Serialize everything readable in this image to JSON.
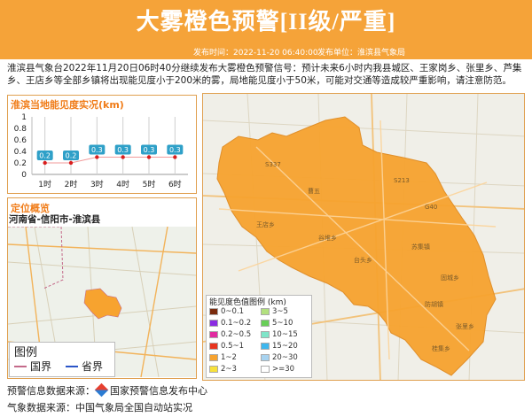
{
  "header": {
    "title": "大雾橙色预警[II级/严重]",
    "time_label": "发布时间：2022-11-20 06:40:00",
    "unit_label": "发布单位：淮滨县气象局",
    "bg_color": "#f5a339"
  },
  "description": "淮滨县气象台2022年11月20日06时40分继续发布大雾橙色预警信号：预计未来6小时内我县城区、王家岗乡、张里乡、芦集乡、王店乡等全部乡镇将出现能见度小于200米的雾，局地能见度小于50米，可能对交通等造成较严重影响，请注意防范。",
  "chart_panel": {
    "title": "淮滨当地能见度实况(km)"
  },
  "chart_data": {
    "type": "line",
    "categories": [
      "1时",
      "2时",
      "3时",
      "4时",
      "5时",
      "6时"
    ],
    "values": [
      0.2,
      0.2,
      0.3,
      0.3,
      0.3,
      0.3
    ],
    "ylim": [
      0,
      1
    ],
    "yticks": [
      "1",
      "0.8",
      "0.6",
      "0.4",
      "0.2",
      "0"
    ],
    "grid": true
  },
  "locator": {
    "title": "定位概览",
    "region": "河南省-信阳市-淮滨县",
    "legend_title": "图例",
    "legend_items": [
      {
        "label": "国界",
        "color": "#c46a8a"
      },
      {
        "label": "省界",
        "color": "#2b55c8"
      }
    ]
  },
  "visibility_legend": {
    "title": "能见度色值图例 (km)",
    "items": [
      {
        "label": "0~0.1",
        "color": "#7a2a0c"
      },
      {
        "label": "3~5",
        "color": "#b2e07e"
      },
      {
        "label": "0.1~0.2",
        "color": "#8a2be2"
      },
      {
        "label": "5~10",
        "color": "#68cf58"
      },
      {
        "label": "0.2~0.5",
        "color": "#e22ba0"
      },
      {
        "label": "10~15",
        "color": "#7fe5c9"
      },
      {
        "label": "0.5~1",
        "color": "#e8351f"
      },
      {
        "label": "15~20",
        "color": "#3eb7ee"
      },
      {
        "label": "1~2",
        "color": "#f7a32f"
      },
      {
        "label": "20~30",
        "color": "#a8d3f0"
      },
      {
        "label": "2~3",
        "color": "#f7e13b"
      },
      {
        "label": ">=30",
        "color": "#ffffff"
      }
    ]
  },
  "map_labels": {
    "inner": [
      "S337",
      "曹五",
      "S213",
      "G40",
      "王店乡",
      "谷堆乡",
      "台头乡",
      "苏集镇",
      "固城乡",
      "防胡镇",
      "张里乡",
      "桂集乡"
    ]
  },
  "footer": {
    "warning_source": "预警信息数据来源：",
    "warning_source_name": "国家预警信息发布中心",
    "weather_source": "气象数据来源：中国气象局全国自动站实况"
  }
}
